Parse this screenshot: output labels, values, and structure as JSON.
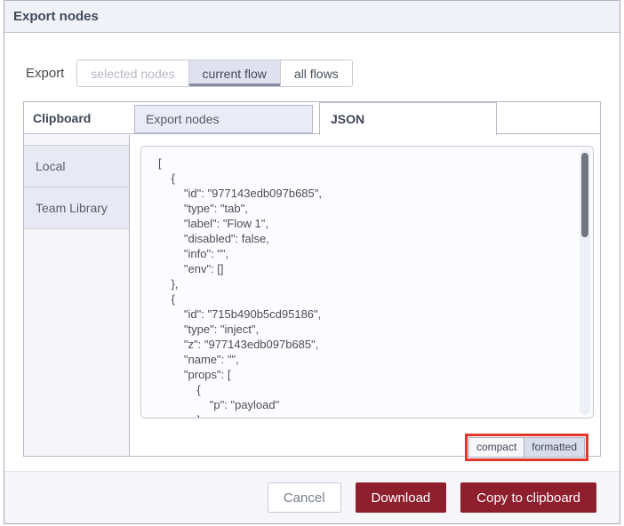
{
  "dialog": {
    "title": "Export nodes",
    "export_row": {
      "label": "Export",
      "options": [
        {
          "label": "selected nodes",
          "state": "disabled"
        },
        {
          "label": "current flow",
          "state": "selected"
        },
        {
          "label": "all flows",
          "state": "normal"
        }
      ]
    },
    "tabs": {
      "section_label": "Clipboard",
      "items": [
        {
          "label": "Export nodes",
          "active": false
        },
        {
          "label": "JSON",
          "active": true
        }
      ]
    },
    "sidebar": {
      "items": [
        {
          "label": "Local"
        },
        {
          "label": "Team Library"
        }
      ]
    },
    "editor": {
      "content": "[\n    {\n        \"id\": \"977143edb097b685\",\n        \"type\": \"tab\",\n        \"label\": \"Flow 1\",\n        \"disabled\": false,\n        \"info\": \"\",\n        \"env\": []\n    },\n    {\n        \"id\": \"715b490b5cd95186\",\n        \"type\": \"inject\",\n        \"z\": \"977143edb097b685\",\n        \"name\": \"\",\n        \"props\": [\n            {\n                \"p\": \"payload\"\n            },"
    },
    "format_toggle": {
      "options": [
        {
          "label": "compact",
          "selected": false
        },
        {
          "label": "formatted",
          "selected": true
        }
      ]
    },
    "footer": {
      "buttons": [
        {
          "label": "Cancel"
        },
        {
          "label": "Download"
        },
        {
          "label": "Copy to clipboard"
        }
      ]
    },
    "colors": {
      "primary_button": "#8e1f2d",
      "annotation_highlight": "#e5352b",
      "selected_segment": "#dfe2ee",
      "header_bg": "#f1f1f8"
    }
  }
}
